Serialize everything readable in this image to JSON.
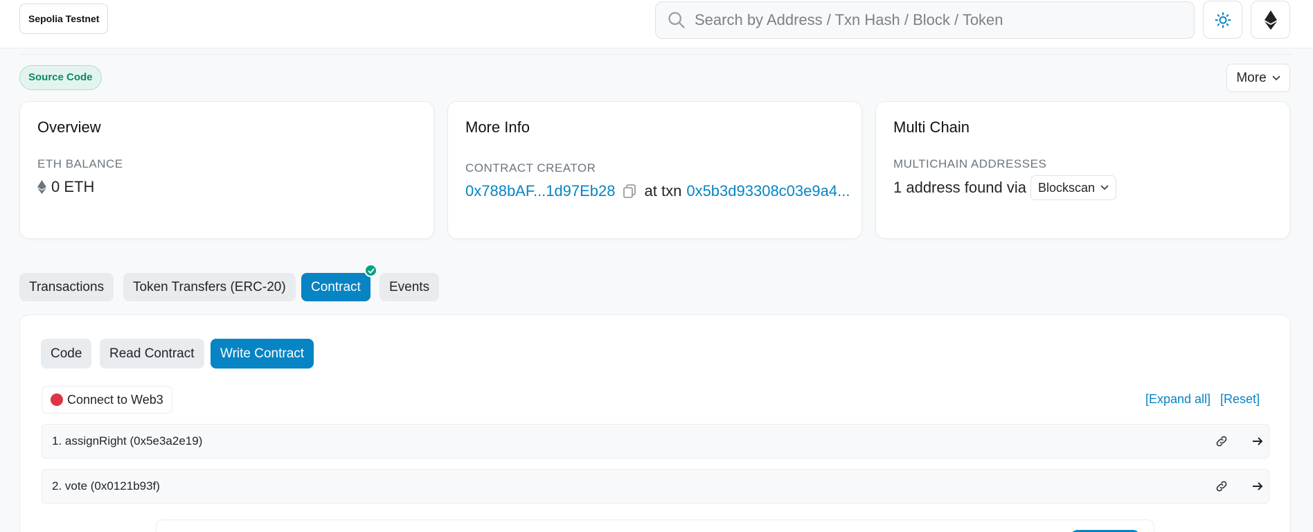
{
  "header": {
    "network": "Sepolia Testnet",
    "search_placeholder": "Search by Address / Txn Hash / Block / Token"
  },
  "badges": {
    "source_code": "Source Code",
    "more": "More"
  },
  "overview": {
    "title": "Overview",
    "balance_label": "ETH BALANCE",
    "balance_value": "0 ETH"
  },
  "more_info": {
    "title": "More Info",
    "creator_label": "CONTRACT CREATOR",
    "creator_address": "0x788bAF...1d97Eb28",
    "at_txn": "at txn",
    "txn_hash": "0x5b3d93308c03e9a4..."
  },
  "multi_chain": {
    "title": "Multi Chain",
    "label": "MULTICHAIN ADDRESSES",
    "found_text": "1 address found via",
    "dropdown": "Blockscan"
  },
  "tabs": [
    "Transactions",
    "Token Transfers (ERC-20)",
    "Contract",
    "Events"
  ],
  "subtabs": [
    "Code",
    "Read Contract",
    "Write Contract"
  ],
  "write": {
    "connect": "Connect to Web3",
    "expand_all": "[Expand all]",
    "reset": "[Reset]",
    "functions": [
      "1. assignRight (0x5e3a2e19)",
      "2. vote (0x0121b93f)"
    ]
  },
  "colors": {
    "primary": "#0784c3",
    "success": "#00a186",
    "danger": "#dc3545"
  }
}
